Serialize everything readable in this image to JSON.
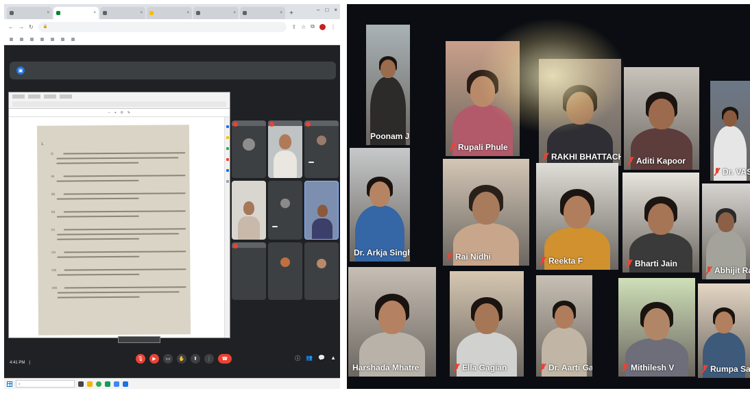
{
  "left_screen": {
    "browser": {
      "tabs": [
        {
          "label": "",
          "active": false
        },
        {
          "label": "",
          "active": true
        },
        {
          "label": "",
          "active": false
        },
        {
          "label": "",
          "active": false
        },
        {
          "label": "",
          "active": false
        },
        {
          "label": "",
          "active": false
        }
      ],
      "url": "",
      "bookmarks": [
        "",
        "",
        "",
        "",
        "",
        "",
        "",
        ""
      ]
    },
    "meet": {
      "presenting_banner": "",
      "shared_doc": {
        "heading": "",
        "item_number": "1.",
        "intro": "",
        "items": [
          "(i)",
          "(ii)",
          "(iii)",
          "(iv)",
          "(v)",
          "(vi)",
          "(vii)",
          "(viii)"
        ]
      },
      "participant_tiles": [
        {
          "name": "",
          "caption": ""
        },
        {
          "name": "",
          "caption": ""
        },
        {
          "name": "",
          "caption": ""
        },
        {
          "name": "",
          "caption": ""
        },
        {
          "name": "",
          "caption": ""
        },
        {
          "name": "",
          "caption": ""
        },
        {
          "name": "",
          "caption": ""
        },
        {
          "name": "",
          "caption": ""
        },
        {
          "name": "",
          "caption": ""
        }
      ],
      "tooltip": "",
      "time": "4:41 PM",
      "meeting_code": "",
      "controls": [
        "mic",
        "camera",
        "captions",
        "raise-hand",
        "present",
        "more",
        "end-call"
      ]
    },
    "taskbar": {
      "search_placeholder": "",
      "clock_time": "",
      "clock_date": ""
    }
  },
  "right_screen": {
    "top_text": "",
    "participants": [
      {
        "name": "Poonam Jain",
        "muted": false
      },
      {
        "name": "Rupali Phule",
        "muted": true
      },
      {
        "name": "RAKHI BHATTACHARYA",
        "muted": true
      },
      {
        "name": "Aditi Kapoor",
        "muted": true
      },
      {
        "name": "Dr. VASUDEO MA",
        "muted": true
      },
      {
        "name": "Dr. Arkja Singh",
        "muted": false
      },
      {
        "name": "Rai Nidhi",
        "muted": true
      },
      {
        "name": "Reekta F",
        "muted": true
      },
      {
        "name": "Bharti Jain",
        "muted": true
      },
      {
        "name": "Abhijit Ra",
        "muted": true
      },
      {
        "name": "Harshada Mhatre",
        "muted": false
      },
      {
        "name": "Ella Gagian",
        "muted": true
      },
      {
        "name": "Dr. Aarti Garg",
        "muted": true
      },
      {
        "name": "Mithilesh V",
        "muted": true
      },
      {
        "name": "Rumpa Sahu",
        "muted": true
      }
    ]
  },
  "colors": {
    "meet_bg": "#202124",
    "meet_surface": "#3c4043",
    "end_call_red": "#ea4335",
    "accent_blue": "#1a73e8"
  }
}
